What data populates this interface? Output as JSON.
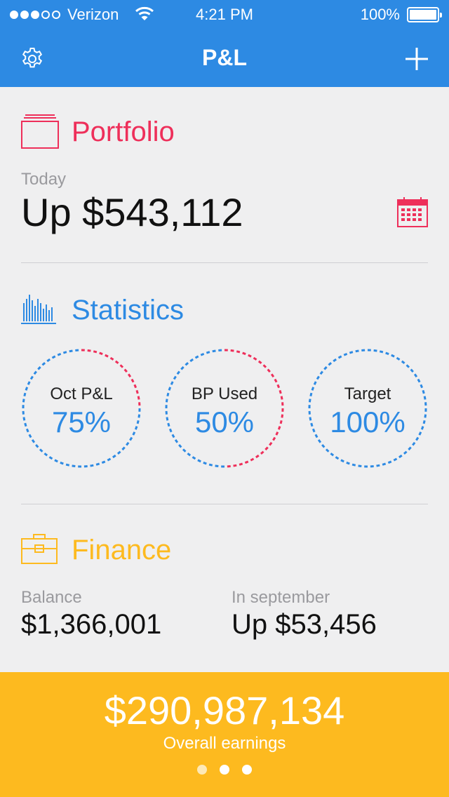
{
  "status_bar": {
    "carrier": "Verizon",
    "time": "4:21 PM",
    "battery": "100%"
  },
  "nav": {
    "title": "P&L",
    "left_icon": "gear-icon",
    "right_icon": "plus-icon"
  },
  "portfolio": {
    "title": "Portfolio",
    "color": "#ee2f5a",
    "period_label": "Today",
    "value": "Up $543,112",
    "icon": "portfolio-icon",
    "action_icon": "calendar-icon"
  },
  "statistics": {
    "title": "Statistics",
    "color": "#2d8ae3",
    "icon": "bar-chart-icon",
    "items": [
      {
        "label": "Oct P&L",
        "value": "75%",
        "fraction": 0.75
      },
      {
        "label": "BP Used",
        "value": "50%",
        "fraction": 0.5
      },
      {
        "label": "Target",
        "value": "100%",
        "fraction": 1.0
      }
    ]
  },
  "finance": {
    "title": "Finance",
    "color": "#fdba1f",
    "icon": "briefcase-icon",
    "balance_label": "Balance",
    "balance_value": "$1,366,001",
    "month_label": "In september",
    "month_value": "Up $53,456"
  },
  "footer": {
    "total": "$290,987,134",
    "total_label": "Overall earnings",
    "page_count": 3,
    "active_page": 1,
    "background": "#fdba1f"
  }
}
